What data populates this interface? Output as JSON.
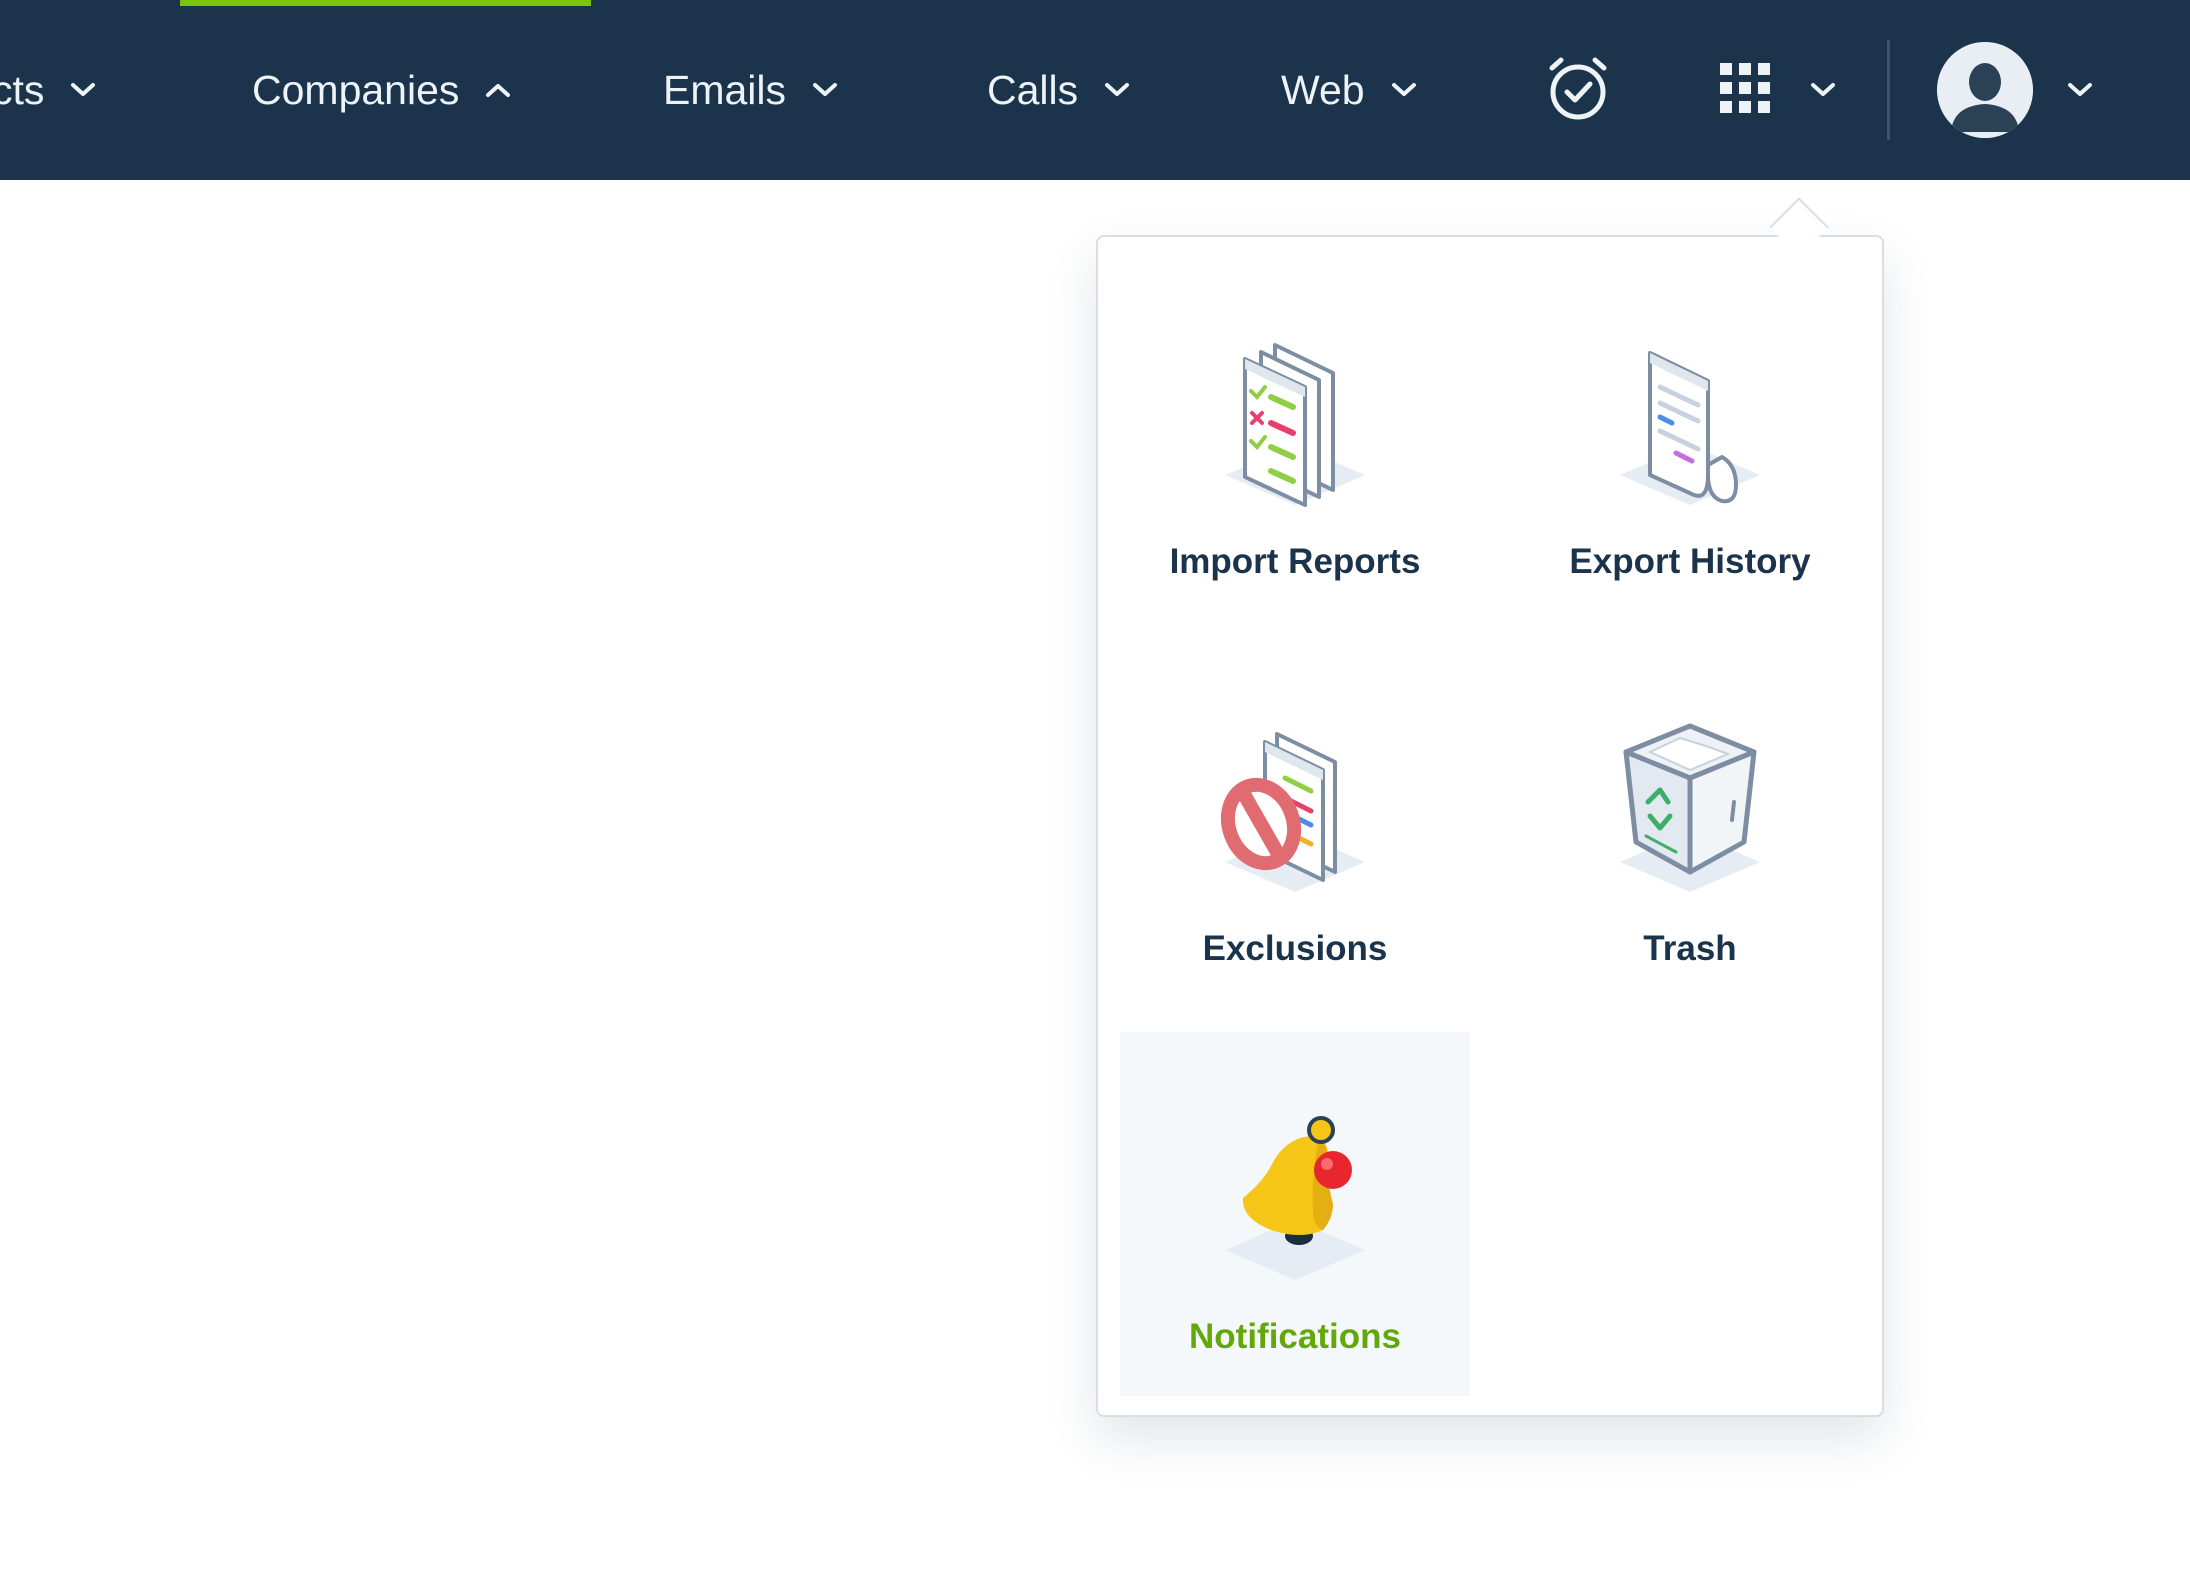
{
  "nav": {
    "items": [
      {
        "label": "cts",
        "state": "collapsed"
      },
      {
        "label": "Companies",
        "state": "expanded",
        "active": true
      },
      {
        "label": "Emails",
        "state": "collapsed"
      },
      {
        "label": "Calls",
        "state": "collapsed"
      },
      {
        "label": "Web",
        "state": "collapsed"
      }
    ],
    "icons": [
      "alarm-clock-icon",
      "apps-grid-icon",
      "chevron-down-icon",
      "avatar",
      "chevron-down-icon"
    ]
  },
  "dropdown": {
    "items": [
      {
        "label": "Import Reports",
        "icon": "import-reports-icon"
      },
      {
        "label": "Export History",
        "icon": "export-history-icon"
      },
      {
        "label": "Exclusions",
        "icon": "exclusions-icon"
      },
      {
        "label": "Trash",
        "icon": "trash-icon"
      },
      {
        "label": "Notifications",
        "icon": "notification-bell-icon",
        "active": true
      }
    ]
  },
  "colors": {
    "nav_bg": "#1b344c",
    "accent_green": "#7ac60f",
    "active_label": "#62a80a",
    "label_dark": "#1b344c",
    "nav_text": "#eef3f7"
  }
}
